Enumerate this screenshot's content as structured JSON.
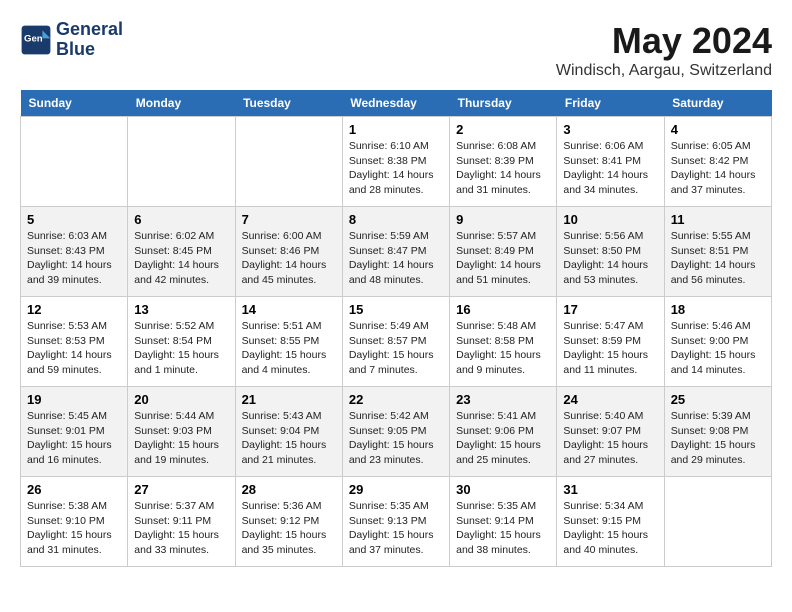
{
  "header": {
    "logo_line1": "General",
    "logo_line2": "Blue",
    "month_title": "May 2024",
    "location": "Windisch, Aargau, Switzerland"
  },
  "days_of_week": [
    "Sunday",
    "Monday",
    "Tuesday",
    "Wednesday",
    "Thursday",
    "Friday",
    "Saturday"
  ],
  "weeks": [
    [
      {
        "num": "",
        "info": ""
      },
      {
        "num": "",
        "info": ""
      },
      {
        "num": "",
        "info": ""
      },
      {
        "num": "1",
        "info": "Sunrise: 6:10 AM\nSunset: 8:38 PM\nDaylight: 14 hours\nand 28 minutes."
      },
      {
        "num": "2",
        "info": "Sunrise: 6:08 AM\nSunset: 8:39 PM\nDaylight: 14 hours\nand 31 minutes."
      },
      {
        "num": "3",
        "info": "Sunrise: 6:06 AM\nSunset: 8:41 PM\nDaylight: 14 hours\nand 34 minutes."
      },
      {
        "num": "4",
        "info": "Sunrise: 6:05 AM\nSunset: 8:42 PM\nDaylight: 14 hours\nand 37 minutes."
      }
    ],
    [
      {
        "num": "5",
        "info": "Sunrise: 6:03 AM\nSunset: 8:43 PM\nDaylight: 14 hours\nand 39 minutes."
      },
      {
        "num": "6",
        "info": "Sunrise: 6:02 AM\nSunset: 8:45 PM\nDaylight: 14 hours\nand 42 minutes."
      },
      {
        "num": "7",
        "info": "Sunrise: 6:00 AM\nSunset: 8:46 PM\nDaylight: 14 hours\nand 45 minutes."
      },
      {
        "num": "8",
        "info": "Sunrise: 5:59 AM\nSunset: 8:47 PM\nDaylight: 14 hours\nand 48 minutes."
      },
      {
        "num": "9",
        "info": "Sunrise: 5:57 AM\nSunset: 8:49 PM\nDaylight: 14 hours\nand 51 minutes."
      },
      {
        "num": "10",
        "info": "Sunrise: 5:56 AM\nSunset: 8:50 PM\nDaylight: 14 hours\nand 53 minutes."
      },
      {
        "num": "11",
        "info": "Sunrise: 5:55 AM\nSunset: 8:51 PM\nDaylight: 14 hours\nand 56 minutes."
      }
    ],
    [
      {
        "num": "12",
        "info": "Sunrise: 5:53 AM\nSunset: 8:53 PM\nDaylight: 14 hours\nand 59 minutes."
      },
      {
        "num": "13",
        "info": "Sunrise: 5:52 AM\nSunset: 8:54 PM\nDaylight: 15 hours\nand 1 minute."
      },
      {
        "num": "14",
        "info": "Sunrise: 5:51 AM\nSunset: 8:55 PM\nDaylight: 15 hours\nand 4 minutes."
      },
      {
        "num": "15",
        "info": "Sunrise: 5:49 AM\nSunset: 8:57 PM\nDaylight: 15 hours\nand 7 minutes."
      },
      {
        "num": "16",
        "info": "Sunrise: 5:48 AM\nSunset: 8:58 PM\nDaylight: 15 hours\nand 9 minutes."
      },
      {
        "num": "17",
        "info": "Sunrise: 5:47 AM\nSunset: 8:59 PM\nDaylight: 15 hours\nand 11 minutes."
      },
      {
        "num": "18",
        "info": "Sunrise: 5:46 AM\nSunset: 9:00 PM\nDaylight: 15 hours\nand 14 minutes."
      }
    ],
    [
      {
        "num": "19",
        "info": "Sunrise: 5:45 AM\nSunset: 9:01 PM\nDaylight: 15 hours\nand 16 minutes."
      },
      {
        "num": "20",
        "info": "Sunrise: 5:44 AM\nSunset: 9:03 PM\nDaylight: 15 hours\nand 19 minutes."
      },
      {
        "num": "21",
        "info": "Sunrise: 5:43 AM\nSunset: 9:04 PM\nDaylight: 15 hours\nand 21 minutes."
      },
      {
        "num": "22",
        "info": "Sunrise: 5:42 AM\nSunset: 9:05 PM\nDaylight: 15 hours\nand 23 minutes."
      },
      {
        "num": "23",
        "info": "Sunrise: 5:41 AM\nSunset: 9:06 PM\nDaylight: 15 hours\nand 25 minutes."
      },
      {
        "num": "24",
        "info": "Sunrise: 5:40 AM\nSunset: 9:07 PM\nDaylight: 15 hours\nand 27 minutes."
      },
      {
        "num": "25",
        "info": "Sunrise: 5:39 AM\nSunset: 9:08 PM\nDaylight: 15 hours\nand 29 minutes."
      }
    ],
    [
      {
        "num": "26",
        "info": "Sunrise: 5:38 AM\nSunset: 9:10 PM\nDaylight: 15 hours\nand 31 minutes."
      },
      {
        "num": "27",
        "info": "Sunrise: 5:37 AM\nSunset: 9:11 PM\nDaylight: 15 hours\nand 33 minutes."
      },
      {
        "num": "28",
        "info": "Sunrise: 5:36 AM\nSunset: 9:12 PM\nDaylight: 15 hours\nand 35 minutes."
      },
      {
        "num": "29",
        "info": "Sunrise: 5:35 AM\nSunset: 9:13 PM\nDaylight: 15 hours\nand 37 minutes."
      },
      {
        "num": "30",
        "info": "Sunrise: 5:35 AM\nSunset: 9:14 PM\nDaylight: 15 hours\nand 38 minutes."
      },
      {
        "num": "31",
        "info": "Sunrise: 5:34 AM\nSunset: 9:15 PM\nDaylight: 15 hours\nand 40 minutes."
      },
      {
        "num": "",
        "info": ""
      }
    ]
  ]
}
